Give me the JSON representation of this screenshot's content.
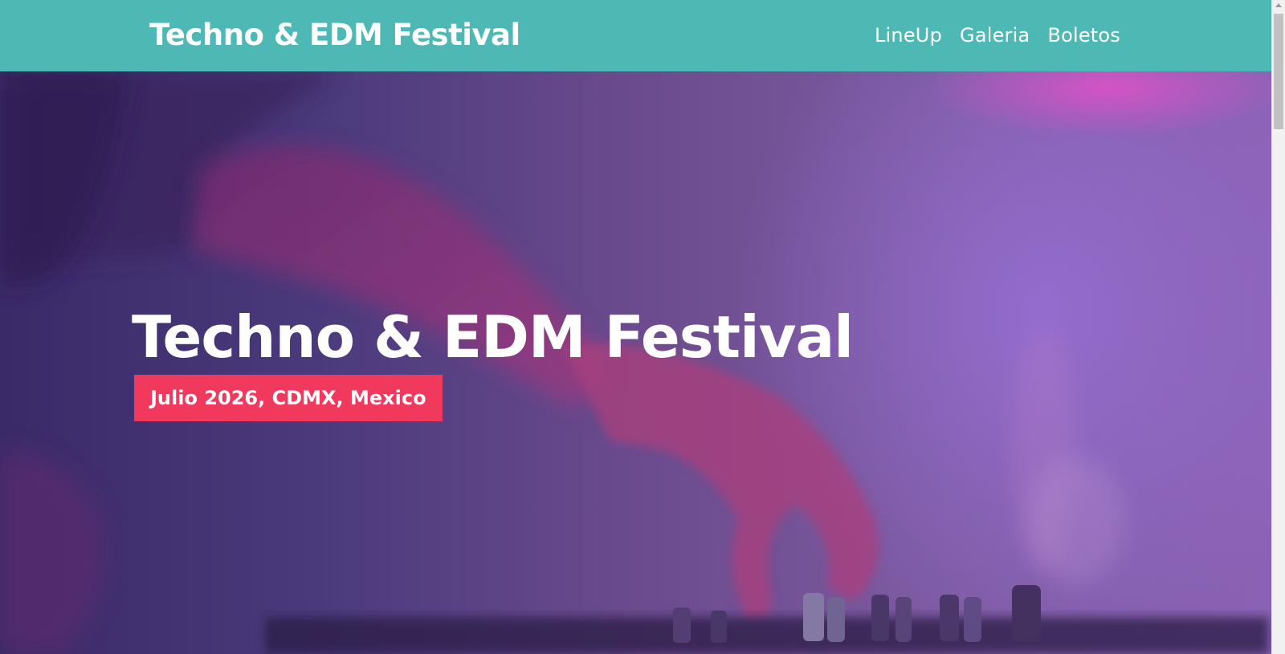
{
  "header": {
    "brand": "Techno & EDM Festival",
    "nav": [
      {
        "label": "LineUp"
      },
      {
        "label": "Galeria"
      },
      {
        "label": "Boletos"
      }
    ]
  },
  "hero": {
    "title": "Techno & EDM Festival",
    "badge": "Julio 2026, CDMX, Mexico",
    "image_subject": "dj-hand-on-mixer-photo"
  },
  "colors": {
    "header_bg": "#4db8b4",
    "badge_bg": "#f0395c",
    "overlay": "#5a3a86",
    "text": "#ffffff"
  },
  "scrollbar": {
    "icon": "scroll-up-arrow-icon"
  }
}
